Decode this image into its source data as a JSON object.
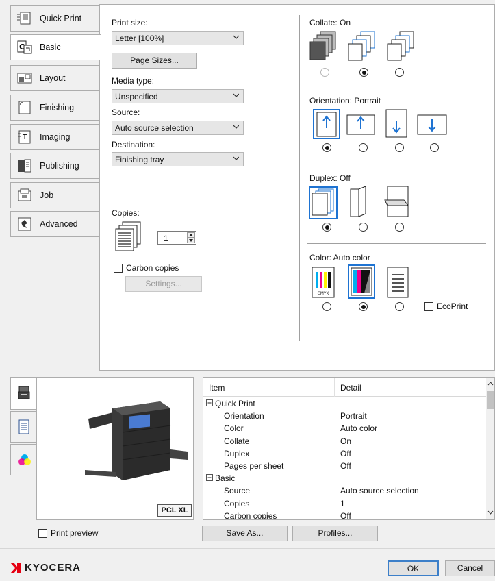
{
  "tabs": [
    {
      "label": "Quick Print",
      "icon": "quick-print-icon"
    },
    {
      "label": "Basic",
      "icon": "basic-icon"
    },
    {
      "label": "Layout",
      "icon": "layout-icon"
    },
    {
      "label": "Finishing",
      "icon": "finishing-icon"
    },
    {
      "label": "Imaging",
      "icon": "imaging-icon"
    },
    {
      "label": "Publishing",
      "icon": "publishing-icon"
    },
    {
      "label": "Job",
      "icon": "job-icon"
    },
    {
      "label": "Advanced",
      "icon": "advanced-icon"
    }
  ],
  "basic": {
    "print_size_label": "Print size:",
    "print_size_value": "Letter [100%]",
    "page_sizes_button": "Page Sizes...",
    "media_type_label": "Media type:",
    "media_type_value": "Unspecified",
    "source_label": "Source:",
    "source_value": "Auto source selection",
    "destination_label": "Destination:",
    "destination_value": "Finishing tray",
    "copies_label": "Copies:",
    "copies_value": "1",
    "carbon_copies_label": "Carbon copies",
    "settings_button": "Settings...",
    "collate_label": "Collate: On",
    "orientation_label": "Orientation: Portrait",
    "duplex_label": "Duplex: Off",
    "color_label": "Color: Auto color",
    "ecoprint_label": "EcoPrint"
  },
  "preview": {
    "pcl_badge": "PCL XL",
    "print_preview_label": "Print preview"
  },
  "table": {
    "col_item": "Item",
    "col_detail": "Detail",
    "rows": [
      {
        "item": "Quick Print",
        "detail": "",
        "group": true
      },
      {
        "item": "Orientation",
        "detail": "Portrait"
      },
      {
        "item": "Color",
        "detail": "Auto color"
      },
      {
        "item": "Collate",
        "detail": "On"
      },
      {
        "item": "Duplex",
        "detail": "Off"
      },
      {
        "item": "Pages per sheet",
        "detail": "Off"
      },
      {
        "item": "Basic",
        "detail": "",
        "group": true
      },
      {
        "item": "Source",
        "detail": "Auto source selection"
      },
      {
        "item": "Copies",
        "detail": "1"
      },
      {
        "item": "Carbon copies",
        "detail": "Off"
      }
    ]
  },
  "footer": {
    "save_as": "Save As...",
    "profiles": "Profiles...",
    "ok": "OK",
    "cancel": "Cancel",
    "brand": "KYOCERA"
  },
  "colors": {
    "brand_red": "#e60012",
    "accent_blue": "#1e73d2"
  }
}
